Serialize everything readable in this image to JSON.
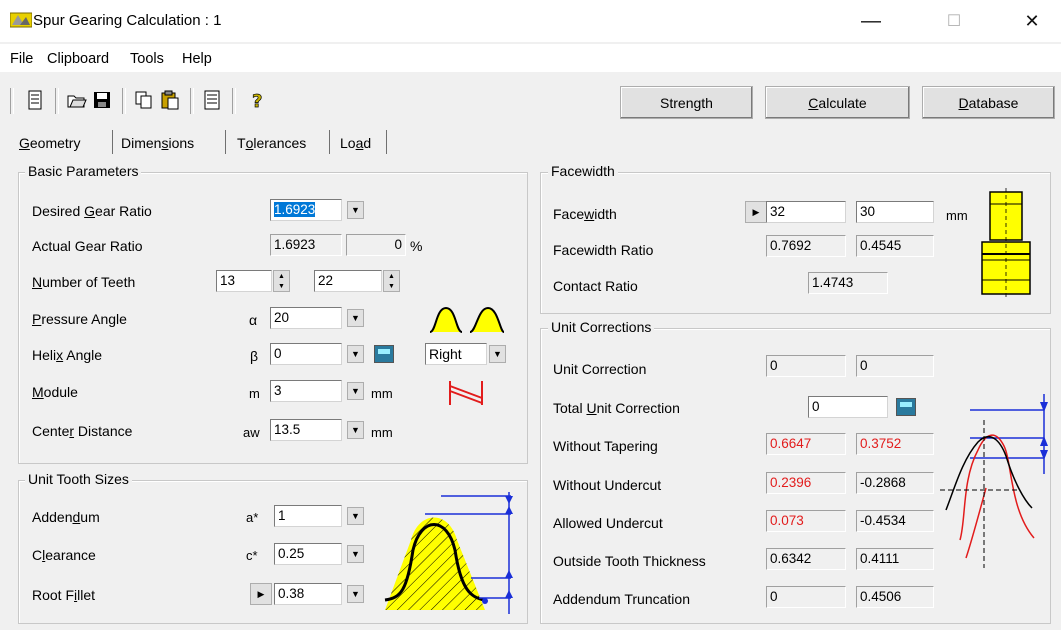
{
  "window": {
    "title": "Spur Gearing Calculation : 1",
    "minimize": "—",
    "maximize": "☐",
    "close": "✕"
  },
  "menu": [
    "File",
    "Clipboard",
    "Tools",
    "Help"
  ],
  "toolbar": {
    "strength": "Strength",
    "calculate": "Calculate",
    "database": "Database",
    "icons": [
      "document-icon",
      "open-folder-icon",
      "save-icon",
      "copy-icon",
      "paste-icon",
      "report-icon",
      "help-icon"
    ]
  },
  "tabs": [
    "Geometry",
    "Dimensions",
    "Tolerances",
    "Load"
  ],
  "basic": {
    "title": "Basic Parameters",
    "desired_ratio_label": "Desired Gear Ratio",
    "desired_ratio": "1.6923",
    "actual_ratio_label": "Actual Gear Ratio",
    "actual_ratio": "1.6923",
    "ratio_dev": "0",
    "pct": "%",
    "teeth_label": "Number of Teeth",
    "teeth1": "13",
    "teeth2": "22",
    "pressure_label": "Pressure Angle",
    "pressure_sym": "α",
    "pressure": "20",
    "helix_label": "Helix Angle",
    "helix_sym": "β",
    "helix": "0",
    "helix_dir": "Right",
    "module_label": "Module",
    "module_sym": "m",
    "module": "3",
    "module_unit": "mm",
    "center_label": "Center Distance",
    "center_sym": "aw",
    "center": "13.5",
    "center_unit": "mm"
  },
  "tooth": {
    "title": "Unit Tooth Sizes",
    "addendum_label": "Addendum",
    "addendum_sym": "a*",
    "addendum": "1",
    "clearance_label": "Clearance",
    "clearance_sym": "c*",
    "clearance": "0.25",
    "fillet_label": "Root Fillet",
    "fillet": "0.38"
  },
  "facewidth": {
    "title": "Facewidth",
    "fw_label": "Facewidth",
    "fw1": "32",
    "fw2": "30",
    "fw_unit": "mm",
    "ratio_label": "Facewidth Ratio",
    "ratio1": "0.7692",
    "ratio2": "0.4545",
    "contact_label": "Contact Ratio",
    "contact": "1.4743"
  },
  "corrections": {
    "title": "Unit Corrections",
    "unit_label": "Unit Correction",
    "unit1": "0",
    "unit2": "0",
    "total_label": "Total Unit Correction",
    "total": "0",
    "taper_label": "Without Tapering",
    "taper1": "0.6647",
    "taper2": "0.3752",
    "undercut_label": "Without Undercut",
    "undercut1": "0.2396",
    "undercut2": "-0.2868",
    "allowed_label": "Allowed Undercut",
    "allowed1": "0.073",
    "allowed2": "-0.4534",
    "thickness_label": "Outside Tooth Thickness",
    "thickness1": "0.6342",
    "thickness2": "0.4111",
    "trunc_label": "Addendum Truncation",
    "trunc1": "0",
    "trunc2": "0.4506"
  },
  "colors": {
    "accent": "#0078d7",
    "warning_text": "#e21c1c",
    "diagram_yellow": "#ffff00"
  }
}
